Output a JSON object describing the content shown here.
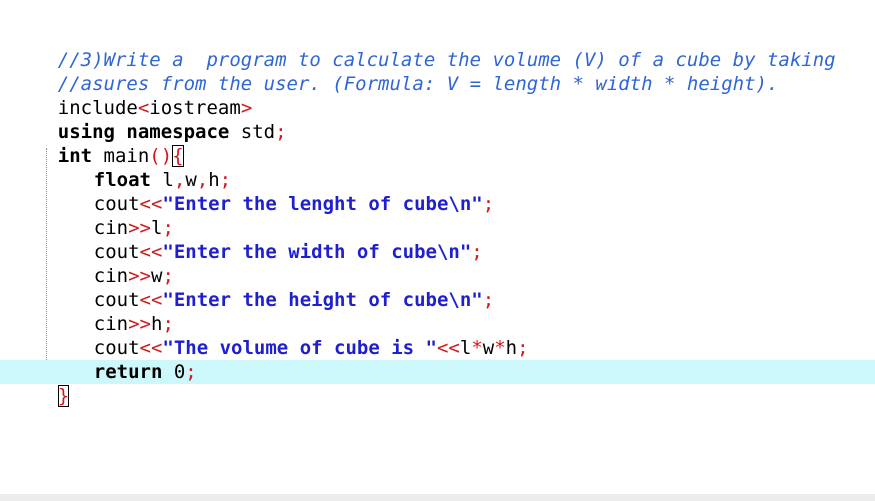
{
  "editor": {
    "lines": {
      "l1": "//3)Write a  program to calculate the volume (V) of a cube by taking",
      "l2": "//asures from the user. (Formula: V = length * width * height).",
      "l3_a": "include",
      "l3_b": "<",
      "l3_c": "iostream",
      "l3_d": ">",
      "l4_a": "using namespace",
      "l4_b": " std",
      "l4_c": ";",
      "l5_a": "int",
      "l5_b": " main",
      "l5_c": "()",
      "l5_d": "{",
      "l6_a": "float",
      "l6_b": " l",
      "l6_c": ",",
      "l6_d": "w",
      "l6_e": ",",
      "l6_f": "h",
      "l6_g": ";",
      "l7_a": "cout",
      "l7_b": "<<",
      "l7_c": "\"Enter the lenght of cube\\n\"",
      "l7_d": ";",
      "l8_a": "cin",
      "l8_b": ">>",
      "l8_c": "l",
      "l8_d": ";",
      "l9_a": "cout",
      "l9_b": "<<",
      "l9_c": "\"Enter the width of cube\\n\"",
      "l9_d": ";",
      "l10_a": "cin",
      "l10_b": ">>",
      "l10_c": "w",
      "l10_d": ";",
      "l11_a": "cout",
      "l11_b": "<<",
      "l11_c": "\"Enter the height of cube\\n\"",
      "l11_d": ";",
      "l12_a": "cin",
      "l12_b": ">>",
      "l12_c": "h",
      "l12_d": ";",
      "l13_a": "cout",
      "l13_b": "<<",
      "l13_c": "\"The volume of cube is \"",
      "l13_d": "<<",
      "l13_e": "l",
      "l13_f": "*",
      "l13_g": "w",
      "l13_h": "*",
      "l13_i": "h",
      "l13_j": ";",
      "l14_a": "return",
      "l14_b": " 0",
      "l14_c": ";",
      "l15": "}"
    },
    "colors": {
      "comment": "#2f66d6",
      "operator": "#d4161b",
      "string": "#1f1fd2",
      "current_line": "#ccf7fb"
    }
  }
}
